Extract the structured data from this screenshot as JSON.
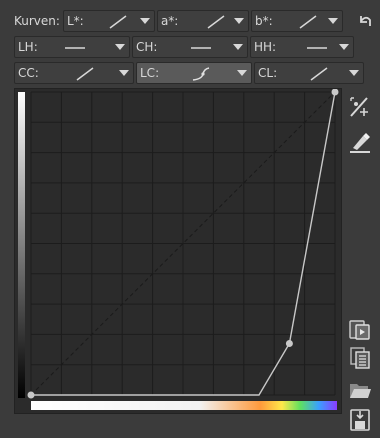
{
  "toolbar": {
    "kurven_label": "Kurven:",
    "row1": [
      {
        "name": "L*:",
        "shape": "diag"
      },
      {
        "name": "a*:",
        "shape": "diag"
      },
      {
        "name": "b*:",
        "shape": "diag"
      }
    ],
    "row2": [
      {
        "name": "LH:",
        "shape": "flat"
      },
      {
        "name": "CH:",
        "shape": "flat"
      },
      {
        "name": "HH:",
        "shape": "flat"
      }
    ],
    "row3": [
      {
        "name": "CC:",
        "shape": "diag"
      },
      {
        "name": "LC:",
        "shape": "custom",
        "active": true
      },
      {
        "name": "CL:",
        "shape": "diag"
      }
    ]
  },
  "icons": {
    "undo": "undo-icon",
    "curve_edit": "curve-edit-icon",
    "eyedropper": "eyedropper-icon",
    "paste": "paste-icon",
    "copy": "copy-icon",
    "open": "folder-open-icon",
    "save": "save-icon"
  },
  "chart_data": {
    "type": "line",
    "xlim": [
      0,
      100
    ],
    "ylim": [
      0,
      100
    ],
    "grid": true,
    "grid_divisions": 10,
    "series": [
      {
        "points": [
          [
            0,
            0
          ],
          [
            75,
            0
          ],
          [
            85,
            17
          ],
          [
            100,
            100
          ]
        ]
      }
    ],
    "control_points": [
      [
        0,
        0
      ],
      [
        85,
        17
      ],
      [
        100,
        100
      ]
    ]
  }
}
